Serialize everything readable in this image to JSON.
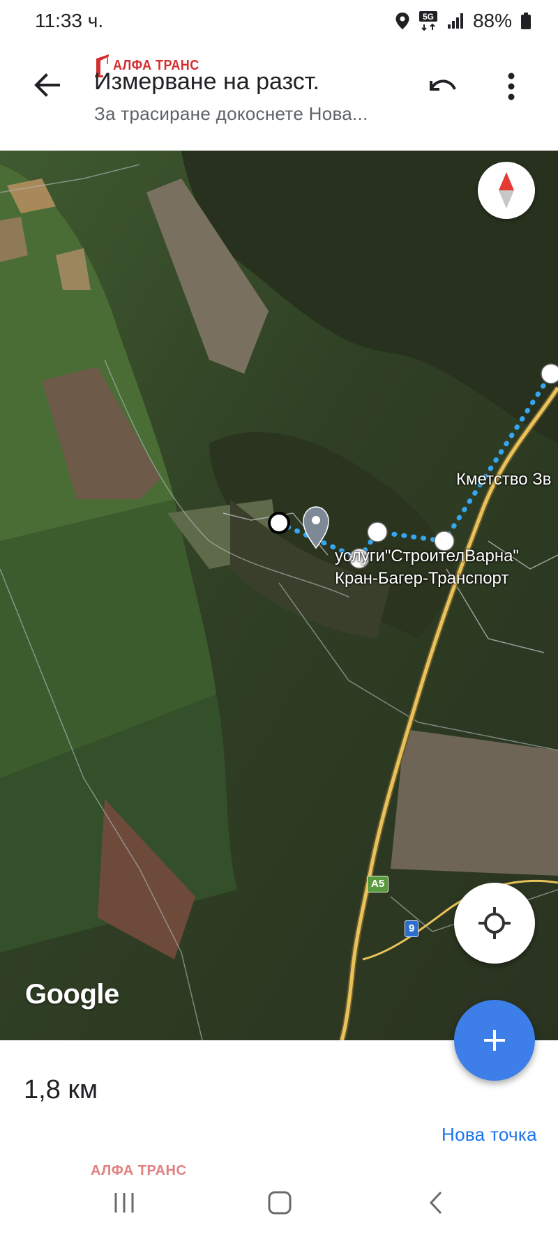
{
  "status_bar": {
    "time": "11:33 ч.",
    "network": "5G",
    "battery": "88%",
    "icons": [
      "location-icon",
      "network-5g-icon",
      "signal-icon",
      "battery-icon"
    ]
  },
  "app_bar": {
    "watermark": "АЛФА ТРАНС",
    "title": "Измерване на разст.",
    "subtitle": "За трасиране докоснете Нова...",
    "icons": [
      "back-arrow-icon",
      "undo-icon",
      "more-vert-icon"
    ]
  },
  "map": {
    "place_name": "услуги\"СтроителВарна\"",
    "place_subtitle": "Кран-Багер-Транспорт",
    "village_label": "Кметство Зв",
    "road_shields": [
      "A5",
      "9"
    ],
    "attribution": "Google",
    "icons": [
      "compass-icon",
      "my-location-icon",
      "place-pin-icon"
    ]
  },
  "bottom_sheet": {
    "distance": "1,8 км",
    "new_point_label": "Нова точка",
    "watermark": "АЛФА ТРАНС"
  },
  "colors": {
    "accent": "#3d7ee8",
    "link": "#1a73e8",
    "route": "#35a7f2",
    "watermark": "#d32f2f",
    "road": "#e8c25a"
  },
  "navigation_bar": {
    "icons": [
      "recent-apps-icon",
      "home-icon",
      "back-icon"
    ]
  }
}
